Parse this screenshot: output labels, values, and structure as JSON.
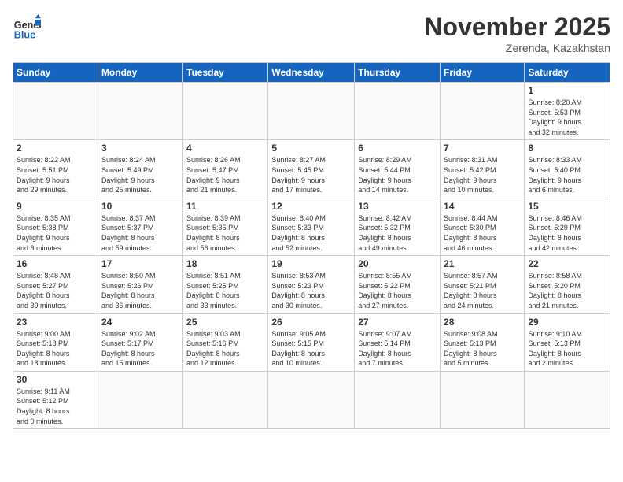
{
  "logo": {
    "line1": "General",
    "line2": "Blue"
  },
  "title": "November 2025",
  "subtitle": "Zerenda, Kazakhstan",
  "weekdays": [
    "Sunday",
    "Monday",
    "Tuesday",
    "Wednesday",
    "Thursday",
    "Friday",
    "Saturday"
  ],
  "weeks": [
    [
      {
        "day": "",
        "info": ""
      },
      {
        "day": "",
        "info": ""
      },
      {
        "day": "",
        "info": ""
      },
      {
        "day": "",
        "info": ""
      },
      {
        "day": "",
        "info": ""
      },
      {
        "day": "",
        "info": ""
      },
      {
        "day": "1",
        "info": "Sunrise: 8:20 AM\nSunset: 5:53 PM\nDaylight: 9 hours\nand 32 minutes."
      }
    ],
    [
      {
        "day": "2",
        "info": "Sunrise: 8:22 AM\nSunset: 5:51 PM\nDaylight: 9 hours\nand 29 minutes."
      },
      {
        "day": "3",
        "info": "Sunrise: 8:24 AM\nSunset: 5:49 PM\nDaylight: 9 hours\nand 25 minutes."
      },
      {
        "day": "4",
        "info": "Sunrise: 8:26 AM\nSunset: 5:47 PM\nDaylight: 9 hours\nand 21 minutes."
      },
      {
        "day": "5",
        "info": "Sunrise: 8:27 AM\nSunset: 5:45 PM\nDaylight: 9 hours\nand 17 minutes."
      },
      {
        "day": "6",
        "info": "Sunrise: 8:29 AM\nSunset: 5:44 PM\nDaylight: 9 hours\nand 14 minutes."
      },
      {
        "day": "7",
        "info": "Sunrise: 8:31 AM\nSunset: 5:42 PM\nDaylight: 9 hours\nand 10 minutes."
      },
      {
        "day": "8",
        "info": "Sunrise: 8:33 AM\nSunset: 5:40 PM\nDaylight: 9 hours\nand 6 minutes."
      }
    ],
    [
      {
        "day": "9",
        "info": "Sunrise: 8:35 AM\nSunset: 5:38 PM\nDaylight: 9 hours\nand 3 minutes."
      },
      {
        "day": "10",
        "info": "Sunrise: 8:37 AM\nSunset: 5:37 PM\nDaylight: 8 hours\nand 59 minutes."
      },
      {
        "day": "11",
        "info": "Sunrise: 8:39 AM\nSunset: 5:35 PM\nDaylight: 8 hours\nand 56 minutes."
      },
      {
        "day": "12",
        "info": "Sunrise: 8:40 AM\nSunset: 5:33 PM\nDaylight: 8 hours\nand 52 minutes."
      },
      {
        "day": "13",
        "info": "Sunrise: 8:42 AM\nSunset: 5:32 PM\nDaylight: 8 hours\nand 49 minutes."
      },
      {
        "day": "14",
        "info": "Sunrise: 8:44 AM\nSunset: 5:30 PM\nDaylight: 8 hours\nand 46 minutes."
      },
      {
        "day": "15",
        "info": "Sunrise: 8:46 AM\nSunset: 5:29 PM\nDaylight: 8 hours\nand 42 minutes."
      }
    ],
    [
      {
        "day": "16",
        "info": "Sunrise: 8:48 AM\nSunset: 5:27 PM\nDaylight: 8 hours\nand 39 minutes."
      },
      {
        "day": "17",
        "info": "Sunrise: 8:50 AM\nSunset: 5:26 PM\nDaylight: 8 hours\nand 36 minutes."
      },
      {
        "day": "18",
        "info": "Sunrise: 8:51 AM\nSunset: 5:25 PM\nDaylight: 8 hours\nand 33 minutes."
      },
      {
        "day": "19",
        "info": "Sunrise: 8:53 AM\nSunset: 5:23 PM\nDaylight: 8 hours\nand 30 minutes."
      },
      {
        "day": "20",
        "info": "Sunrise: 8:55 AM\nSunset: 5:22 PM\nDaylight: 8 hours\nand 27 minutes."
      },
      {
        "day": "21",
        "info": "Sunrise: 8:57 AM\nSunset: 5:21 PM\nDaylight: 8 hours\nand 24 minutes."
      },
      {
        "day": "22",
        "info": "Sunrise: 8:58 AM\nSunset: 5:20 PM\nDaylight: 8 hours\nand 21 minutes."
      }
    ],
    [
      {
        "day": "23",
        "info": "Sunrise: 9:00 AM\nSunset: 5:18 PM\nDaylight: 8 hours\nand 18 minutes."
      },
      {
        "day": "24",
        "info": "Sunrise: 9:02 AM\nSunset: 5:17 PM\nDaylight: 8 hours\nand 15 minutes."
      },
      {
        "day": "25",
        "info": "Sunrise: 9:03 AM\nSunset: 5:16 PM\nDaylight: 8 hours\nand 12 minutes."
      },
      {
        "day": "26",
        "info": "Sunrise: 9:05 AM\nSunset: 5:15 PM\nDaylight: 8 hours\nand 10 minutes."
      },
      {
        "day": "27",
        "info": "Sunrise: 9:07 AM\nSunset: 5:14 PM\nDaylight: 8 hours\nand 7 minutes."
      },
      {
        "day": "28",
        "info": "Sunrise: 9:08 AM\nSunset: 5:13 PM\nDaylight: 8 hours\nand 5 minutes."
      },
      {
        "day": "29",
        "info": "Sunrise: 9:10 AM\nSunset: 5:13 PM\nDaylight: 8 hours\nand 2 minutes."
      }
    ],
    [
      {
        "day": "30",
        "info": "Sunrise: 9:11 AM\nSunset: 5:12 PM\nDaylight: 8 hours\nand 0 minutes."
      },
      {
        "day": "",
        "info": ""
      },
      {
        "day": "",
        "info": ""
      },
      {
        "day": "",
        "info": ""
      },
      {
        "day": "",
        "info": ""
      },
      {
        "day": "",
        "info": ""
      },
      {
        "day": "",
        "info": ""
      }
    ]
  ]
}
